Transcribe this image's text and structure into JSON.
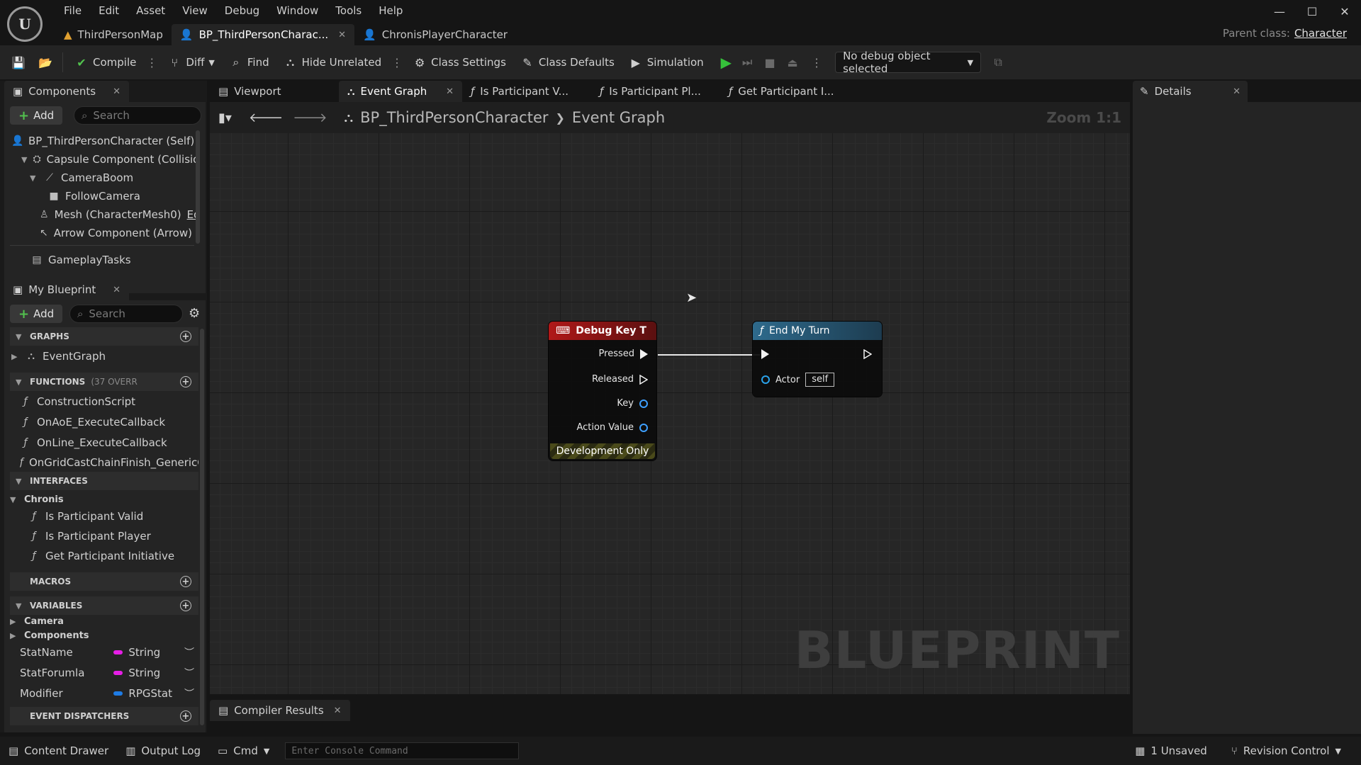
{
  "menu": [
    "File",
    "Edit",
    "Asset",
    "View",
    "Debug",
    "Window",
    "Tools",
    "Help"
  ],
  "doc_tabs": [
    {
      "label": "ThirdPersonMap"
    },
    {
      "label": "BP_ThirdPersonCharac..."
    },
    {
      "label": "ChronisPlayerCharacter"
    }
  ],
  "parent_class": {
    "label": "Parent class:",
    "value": "Character"
  },
  "toolbar": {
    "compile": "Compile",
    "diff": "Diff",
    "find": "Find",
    "hide_unrelated": "Hide Unrelated",
    "class_settings": "Class Settings",
    "class_defaults": "Class Defaults",
    "simulation": "Simulation",
    "debug_object": "No debug object selected"
  },
  "components": {
    "tab": "Components",
    "add": "Add",
    "search_placeholder": "Search",
    "tree": [
      "BP_ThirdPersonCharacter (Self)",
      "Capsule Component (Collision",
      "CameraBoom",
      "FollowCamera",
      "Mesh (CharacterMesh0)",
      "Arrow Component (Arrow)",
      "GameplayTasks"
    ],
    "mesh_edit": "Edi",
    "arrow_edit": "E"
  },
  "my_blueprint": {
    "tab": "My Blueprint",
    "add": "Add",
    "search_placeholder": "Search",
    "graphs_header": "GRAPHS",
    "event_graph": "EventGraph",
    "functions_header": "FUNCTIONS",
    "functions_sub": "(37 OVERR",
    "functions": [
      "ConstructionScript",
      "OnAoE_ExecuteCallback",
      "OnLine_ExecuteCallback",
      "OnGridCastChainFinish_GenericC"
    ],
    "interfaces_header": "INTERFACES",
    "interface_group": "Chronis",
    "interfaces": [
      "Is Participant Valid",
      "Is Participant Player",
      "Get Participant Initiative"
    ],
    "macros_header": "MACROS",
    "variables_header": "VARIABLES",
    "var_categories": [
      "Camera",
      "Components"
    ],
    "variables": [
      {
        "name": "StatName",
        "type": "String",
        "color": "#e61ee6"
      },
      {
        "name": "StatForumla",
        "type": "String",
        "color": "#e61ee6"
      },
      {
        "name": "Modifier",
        "type": "RPGStat",
        "color": "#1e7ce6"
      }
    ],
    "dispatchers_header": "EVENT DISPATCHERS"
  },
  "graph_tabs": [
    {
      "label": "Viewport"
    },
    {
      "label": "Event Graph"
    },
    {
      "label": "Is Participant V..."
    },
    {
      "label": "Is Participant Pl..."
    },
    {
      "label": "Get Participant I..."
    }
  ],
  "breadcrumb": {
    "root": "BP_ThirdPersonCharacter",
    "current": "Event Graph"
  },
  "zoom": "Zoom 1:1",
  "watermark": "BLUEPRINT",
  "nodes": {
    "debug_key": {
      "title": "Debug Key T",
      "pins": [
        "Pressed",
        "Released",
        "Key",
        "Action Value"
      ],
      "footer": "Development Only",
      "header_color": "#b01818"
    },
    "end_turn": {
      "title": "End My Turn",
      "actor_label": "Actor",
      "actor_value": "self",
      "header_color": "#2e6a8c"
    }
  },
  "compiler_results": "Compiler Results",
  "details": {
    "tab": "Details"
  },
  "statusbar": {
    "content_drawer": "Content Drawer",
    "output_log": "Output Log",
    "cmd": "Cmd",
    "console_placeholder": "Enter Console Command",
    "unsaved": "1 Unsaved",
    "revision_control": "Revision Control"
  }
}
